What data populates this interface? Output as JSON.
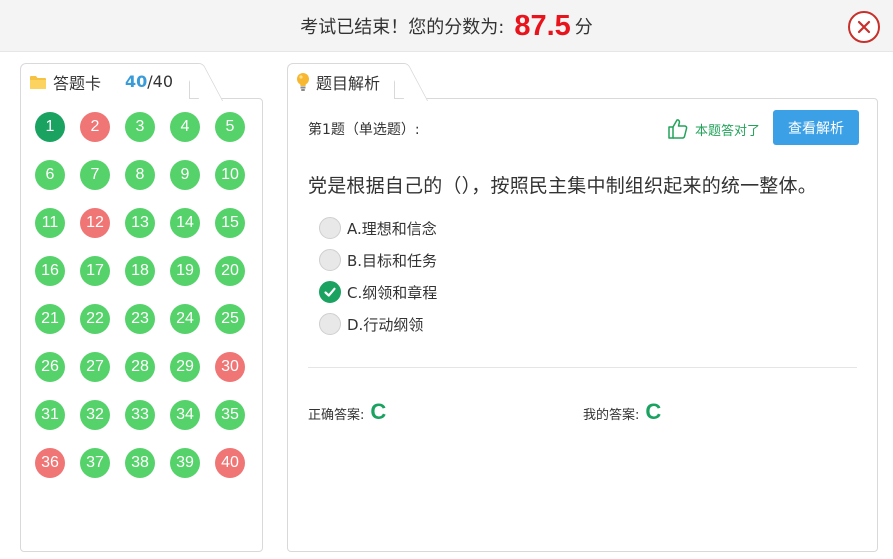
{
  "banner": {
    "prefix": "考试已结束！您的分数为:",
    "score": "87.5",
    "suffix": "分"
  },
  "answer_card": {
    "tab_label": "答题卡",
    "done": "40",
    "total": "/40",
    "items": [
      {
        "n": "1",
        "s": "current"
      },
      {
        "n": "2",
        "s": "wrong"
      },
      {
        "n": "3",
        "s": "correct"
      },
      {
        "n": "4",
        "s": "correct"
      },
      {
        "n": "5",
        "s": "correct"
      },
      {
        "n": "6",
        "s": "correct"
      },
      {
        "n": "7",
        "s": "correct"
      },
      {
        "n": "8",
        "s": "correct"
      },
      {
        "n": "9",
        "s": "correct"
      },
      {
        "n": "10",
        "s": "correct"
      },
      {
        "n": "11",
        "s": "correct"
      },
      {
        "n": "12",
        "s": "wrong"
      },
      {
        "n": "13",
        "s": "correct"
      },
      {
        "n": "14",
        "s": "correct"
      },
      {
        "n": "15",
        "s": "correct"
      },
      {
        "n": "16",
        "s": "correct"
      },
      {
        "n": "17",
        "s": "correct"
      },
      {
        "n": "18",
        "s": "correct"
      },
      {
        "n": "19",
        "s": "correct"
      },
      {
        "n": "20",
        "s": "correct"
      },
      {
        "n": "21",
        "s": "correct"
      },
      {
        "n": "22",
        "s": "correct"
      },
      {
        "n": "23",
        "s": "correct"
      },
      {
        "n": "24",
        "s": "correct"
      },
      {
        "n": "25",
        "s": "correct"
      },
      {
        "n": "26",
        "s": "correct"
      },
      {
        "n": "27",
        "s": "correct"
      },
      {
        "n": "28",
        "s": "correct"
      },
      {
        "n": "29",
        "s": "correct"
      },
      {
        "n": "30",
        "s": "wrong"
      },
      {
        "n": "31",
        "s": "correct"
      },
      {
        "n": "32",
        "s": "correct"
      },
      {
        "n": "33",
        "s": "correct"
      },
      {
        "n": "34",
        "s": "correct"
      },
      {
        "n": "35",
        "s": "correct"
      },
      {
        "n": "36",
        "s": "wrong"
      },
      {
        "n": "37",
        "s": "correct"
      },
      {
        "n": "38",
        "s": "correct"
      },
      {
        "n": "39",
        "s": "correct"
      },
      {
        "n": "40",
        "s": "wrong"
      }
    ]
  },
  "analysis": {
    "tab_label": "题目解析",
    "question_header": "第1题（单选题）:",
    "result_text": "本题答对了",
    "explain_button": "查看解析",
    "question_text": "党是根据自己的（），按照民主集中制组织起来的统一整体。",
    "options": [
      {
        "label": "A.理想和信念",
        "checked": false
      },
      {
        "label": "B.目标和任务",
        "checked": false
      },
      {
        "label": "C.纲领和章程",
        "checked": true
      },
      {
        "label": "D.行动纲领",
        "checked": false
      }
    ],
    "correct_label": "正确答案:",
    "correct_value": "C",
    "my_label": "我的答案:",
    "my_value": "C"
  },
  "colors": {
    "score_red": "#e8131b",
    "correct_green": "#56d26b",
    "wrong_red": "#f07575",
    "current_green": "#1aa260",
    "button_blue": "#3ca0e6",
    "count_blue": "#3a9bd9"
  },
  "icons": {
    "close": "close-circle-icon",
    "folder": "folder-icon",
    "bulb": "lightbulb-icon",
    "thumb": "thumbs-up-icon",
    "check": "check-icon"
  }
}
